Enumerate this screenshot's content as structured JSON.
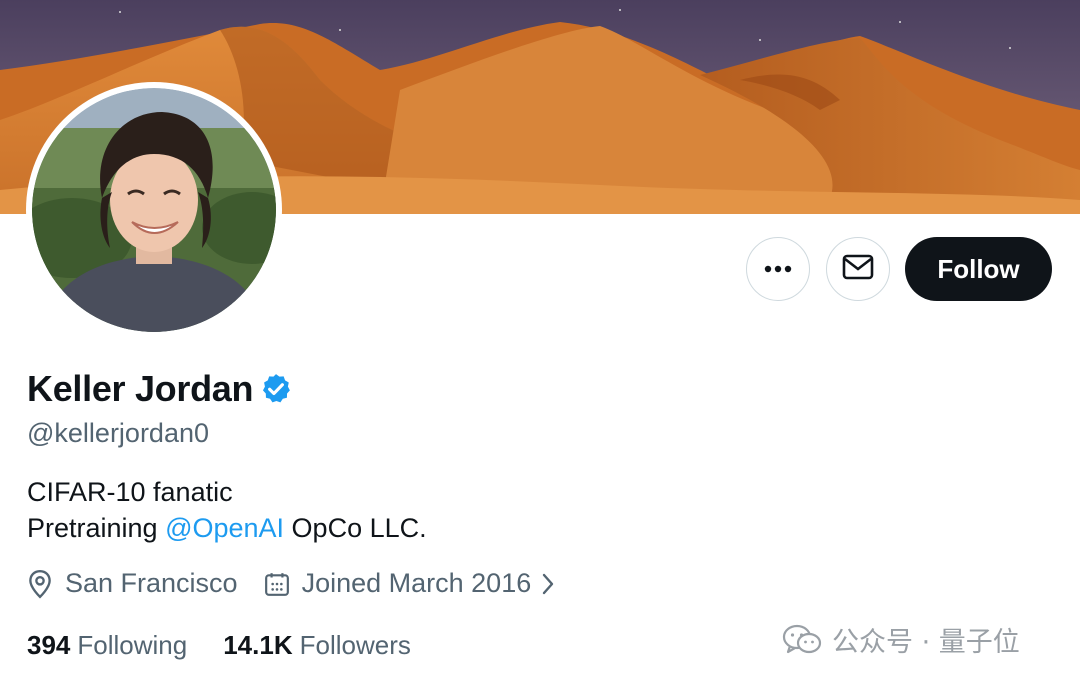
{
  "profile": {
    "display_name": "Keller Jordan",
    "handle": "@kellerjordan0",
    "bio_line1": "CIFAR-10 fanatic",
    "bio_line2_prefix": "Pretraining ",
    "bio_mention": "@OpenAI",
    "bio_line2_suffix": " OpCo LLC.",
    "location": "San Francisco",
    "joined": "Joined March 2016",
    "following_count": "394",
    "following_label": "Following",
    "followers_count": "14.1K",
    "followers_label": "Followers",
    "verified": true
  },
  "actions": {
    "more_icon": "more-horizontal-icon",
    "message_icon": "envelope-icon",
    "follow_label": "Follow"
  },
  "icons": {
    "location": "map-pin-icon",
    "calendar": "calendar-icon",
    "chevron": "chevron-right-icon",
    "verified": "verified-badge-icon"
  },
  "watermark": {
    "text": "公众号 · 量子位",
    "logo": "wechat-icon"
  },
  "colors": {
    "accent": "#1d9bf0",
    "follow_bg": "#0f1419",
    "secondary_text": "#536471",
    "banner_sand": "#d27a2c",
    "banner_sky": "#5a4a6a"
  }
}
